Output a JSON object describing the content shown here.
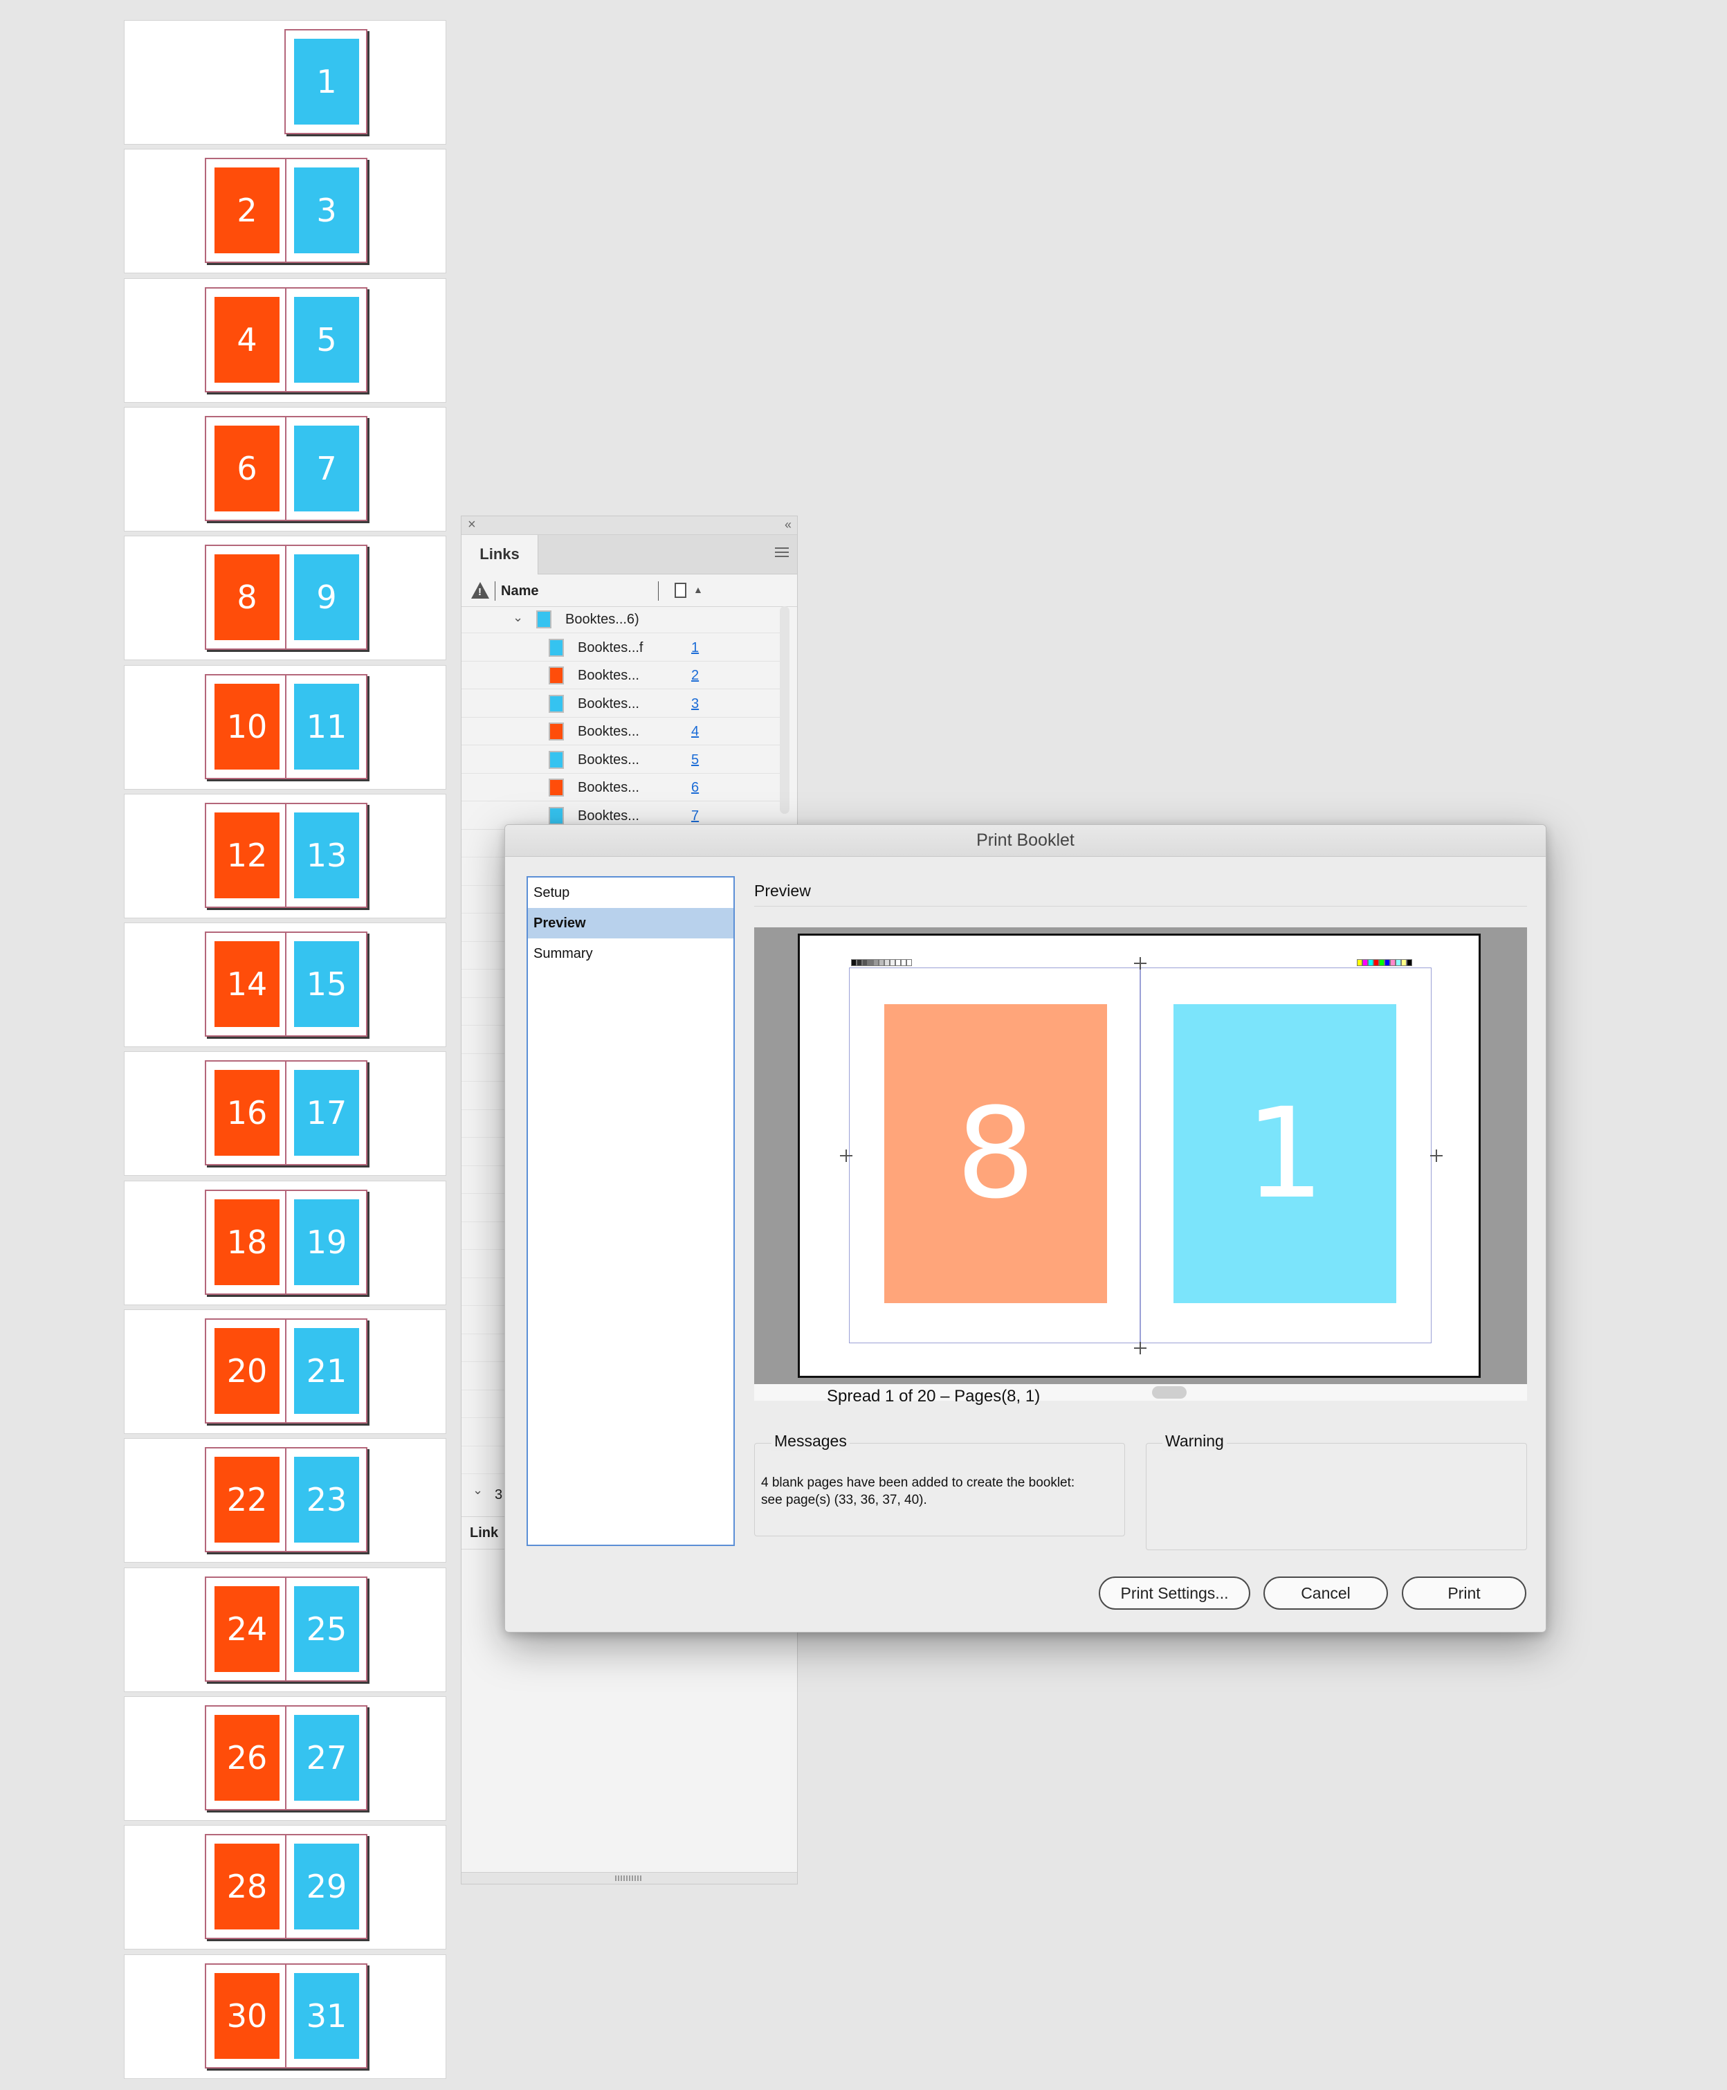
{
  "pages_panel": {
    "spreads": [
      {
        "pages": [
          "1"
        ],
        "colors": [
          "blue"
        ]
      },
      {
        "pages": [
          "2",
          "3"
        ],
        "colors": [
          "orange",
          "blue"
        ]
      },
      {
        "pages": [
          "4",
          "5"
        ],
        "colors": [
          "orange",
          "blue"
        ]
      },
      {
        "pages": [
          "6",
          "7"
        ],
        "colors": [
          "orange",
          "blue"
        ]
      },
      {
        "pages": [
          "8",
          "9"
        ],
        "colors": [
          "orange",
          "blue"
        ]
      },
      {
        "pages": [
          "10",
          "11"
        ],
        "colors": [
          "orange",
          "blue"
        ]
      },
      {
        "pages": [
          "12",
          "13"
        ],
        "colors": [
          "orange",
          "blue"
        ]
      },
      {
        "pages": [
          "14",
          "15"
        ],
        "colors": [
          "orange",
          "blue"
        ]
      },
      {
        "pages": [
          "16",
          "17"
        ],
        "colors": [
          "orange",
          "blue"
        ]
      },
      {
        "pages": [
          "18",
          "19"
        ],
        "colors": [
          "orange",
          "blue"
        ]
      },
      {
        "pages": [
          "20",
          "21"
        ],
        "colors": [
          "orange",
          "blue"
        ]
      },
      {
        "pages": [
          "22",
          "23"
        ],
        "colors": [
          "orange",
          "blue"
        ]
      },
      {
        "pages": [
          "24",
          "25"
        ],
        "colors": [
          "orange",
          "blue"
        ]
      },
      {
        "pages": [
          "26",
          "27"
        ],
        "colors": [
          "orange",
          "blue"
        ]
      },
      {
        "pages": [
          "28",
          "29"
        ],
        "colors": [
          "orange",
          "blue"
        ]
      },
      {
        "pages": [
          "30",
          "31"
        ],
        "colors": [
          "orange",
          "blue"
        ]
      }
    ]
  },
  "links_panel": {
    "tab_label": "Links",
    "column_name": "Name",
    "parent_item": {
      "name": "Booktes...6)",
      "color": "blue"
    },
    "items": [
      {
        "name": "Booktes...f",
        "page": "1",
        "color": "blue"
      },
      {
        "name": "Booktes...",
        "page": "2",
        "color": "orange"
      },
      {
        "name": "Booktes...",
        "page": "3",
        "color": "blue"
      },
      {
        "name": "Booktes...",
        "page": "4",
        "color": "orange"
      },
      {
        "name": "Booktes...",
        "page": "5",
        "color": "blue"
      },
      {
        "name": "Booktes...",
        "page": "6",
        "color": "orange"
      },
      {
        "name": "Booktes...",
        "page": "7",
        "color": "blue"
      }
    ],
    "group_count": "3",
    "link_info_label": "Link"
  },
  "dialog": {
    "title": "Print Booklet",
    "nav": [
      "Setup",
      "Preview",
      "Summary"
    ],
    "selected_nav": "Preview",
    "section_title": "Preview",
    "preview": {
      "left_page": "8",
      "right_page": "1"
    },
    "spread_info": "Spread 1 of 20 – Pages(8, 1)",
    "messages_label": "Messages",
    "messages_text": "4 blank pages have been added to create the booklet: see page(s) (33, 36, 37, 40).",
    "warning_label": "Warning",
    "buttons": {
      "print_settings": "Print Settings...",
      "cancel": "Cancel",
      "print": "Print"
    }
  },
  "colors": {
    "orange": "#ff4d0a",
    "blue": "#35c3f0",
    "preview_orange": "#ffa57a",
    "preview_blue": "#7be4fb",
    "selection": "#b8d1ec"
  }
}
